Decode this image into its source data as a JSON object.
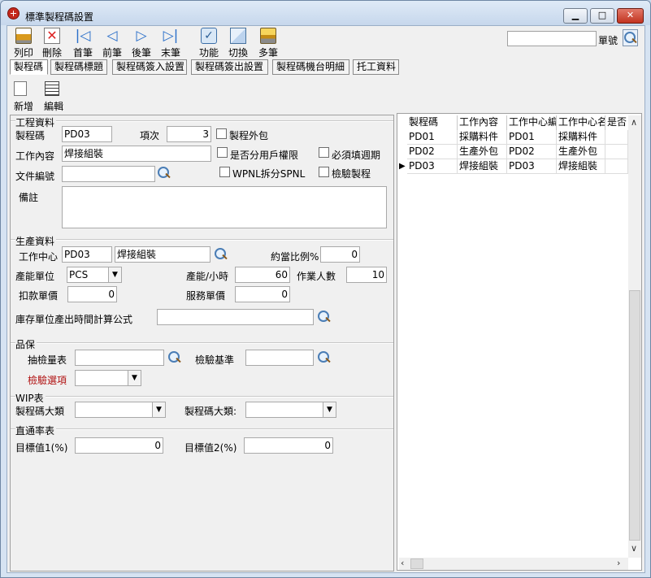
{
  "window": {
    "title": "標準製程碼設置"
  },
  "toolbar": [
    {
      "id": "print",
      "label": "列印",
      "icon": "printer-icon"
    },
    {
      "id": "delete",
      "label": "刪除",
      "icon": "delete-icon"
    },
    {
      "id": "first",
      "label": "首筆",
      "icon": "first-record-icon"
    },
    {
      "id": "prev",
      "label": "前筆",
      "icon": "previous-record-icon"
    },
    {
      "id": "next",
      "label": "後筆",
      "icon": "next-record-icon"
    },
    {
      "id": "last",
      "label": "末筆",
      "icon": "last-record-icon"
    },
    {
      "id": "func",
      "label": "功能",
      "icon": "function-icon"
    },
    {
      "id": "switch",
      "label": "切換",
      "icon": "switch-icon"
    },
    {
      "id": "multi",
      "label": "多筆",
      "icon": "multi-record-icon"
    }
  ],
  "toolbar_glyphs": {
    "delete": "✕",
    "first": "|◁",
    "prev": "◁",
    "next": "▷",
    "last": "▷|",
    "func": "✓"
  },
  "doc_search": {
    "label": "單號",
    "value": ""
  },
  "tabs": [
    "製程碼",
    "製程碼標題",
    "製程碼簽入設置",
    "製程碼簽出設置",
    "製程碼機台明細",
    "托工資料"
  ],
  "actions": [
    {
      "id": "new",
      "label": "新增",
      "icon": "new-document-icon"
    },
    {
      "id": "edit",
      "label": "編輯",
      "icon": "edit-icon"
    }
  ],
  "engineering": {
    "section": "工程資料",
    "code_label": "製程碼",
    "code_value": "PD03",
    "seq_label": "項次",
    "seq_value": "3",
    "outsource_label": "製程外包",
    "outsource_checked": false,
    "content_label": "工作內容",
    "content_value": "焊接組裝",
    "user_perm_label": "是否分用戶權限",
    "user_perm_checked": false,
    "required_label": "必須填週期",
    "required_checked": false,
    "doc_label": "文件編號",
    "doc_value": "",
    "wpnl_label": "WPNL拆分SPNL",
    "wpnl_checked": false,
    "inspect_label": "檢驗製程",
    "inspect_checked": false,
    "remark_label": "備註",
    "remark_value": ""
  },
  "production": {
    "section": "生產資料",
    "wc_label": "工作中心",
    "wc_code": "PD03",
    "wc_name": "焊接組裝",
    "ratio_label": "約當比例%",
    "ratio_value": "0",
    "unit_label": "產能單位",
    "unit_value": "PCS",
    "per_hour_label": "產能/小時",
    "per_hour_value": "60",
    "workers_label": "作業人數",
    "workers_value": "10",
    "deduct_label": "扣款單價",
    "deduct_value": "0",
    "service_label": "服務單價",
    "service_value": "0",
    "formula_label": "庫存單位產出時間計算公式",
    "formula_value": ""
  },
  "qa": {
    "section": "品保",
    "sampling_label": "抽檢量表",
    "sampling_value": "",
    "standard_label": "檢驗基準",
    "standard_value": "",
    "option_label": "檢驗選項",
    "option_value": ""
  },
  "wip": {
    "section": "WIP表",
    "cat1_label": "製程碼大類",
    "cat1_value": "",
    "cat2_label": "製程碼大類:",
    "cat2_value": ""
  },
  "yield": {
    "section": "直通率表",
    "target1_label": "目標值1(%)",
    "target1_value": "0",
    "target2_label": "目標值2(%)",
    "target2_value": "0"
  },
  "grid": {
    "columns": [
      "製程碼",
      "工作內容",
      "工作中心編",
      "工作中心名",
      "是否"
    ],
    "rows": [
      [
        "PD01",
        "採購料件",
        "PD01",
        "採購料件",
        ""
      ],
      [
        "PD02",
        "生產外包",
        "PD02",
        "生產外包",
        ""
      ],
      [
        "PD03",
        "焊接組裝",
        "PD03",
        "焊接組裝",
        ""
      ]
    ],
    "current_row": 2
  }
}
